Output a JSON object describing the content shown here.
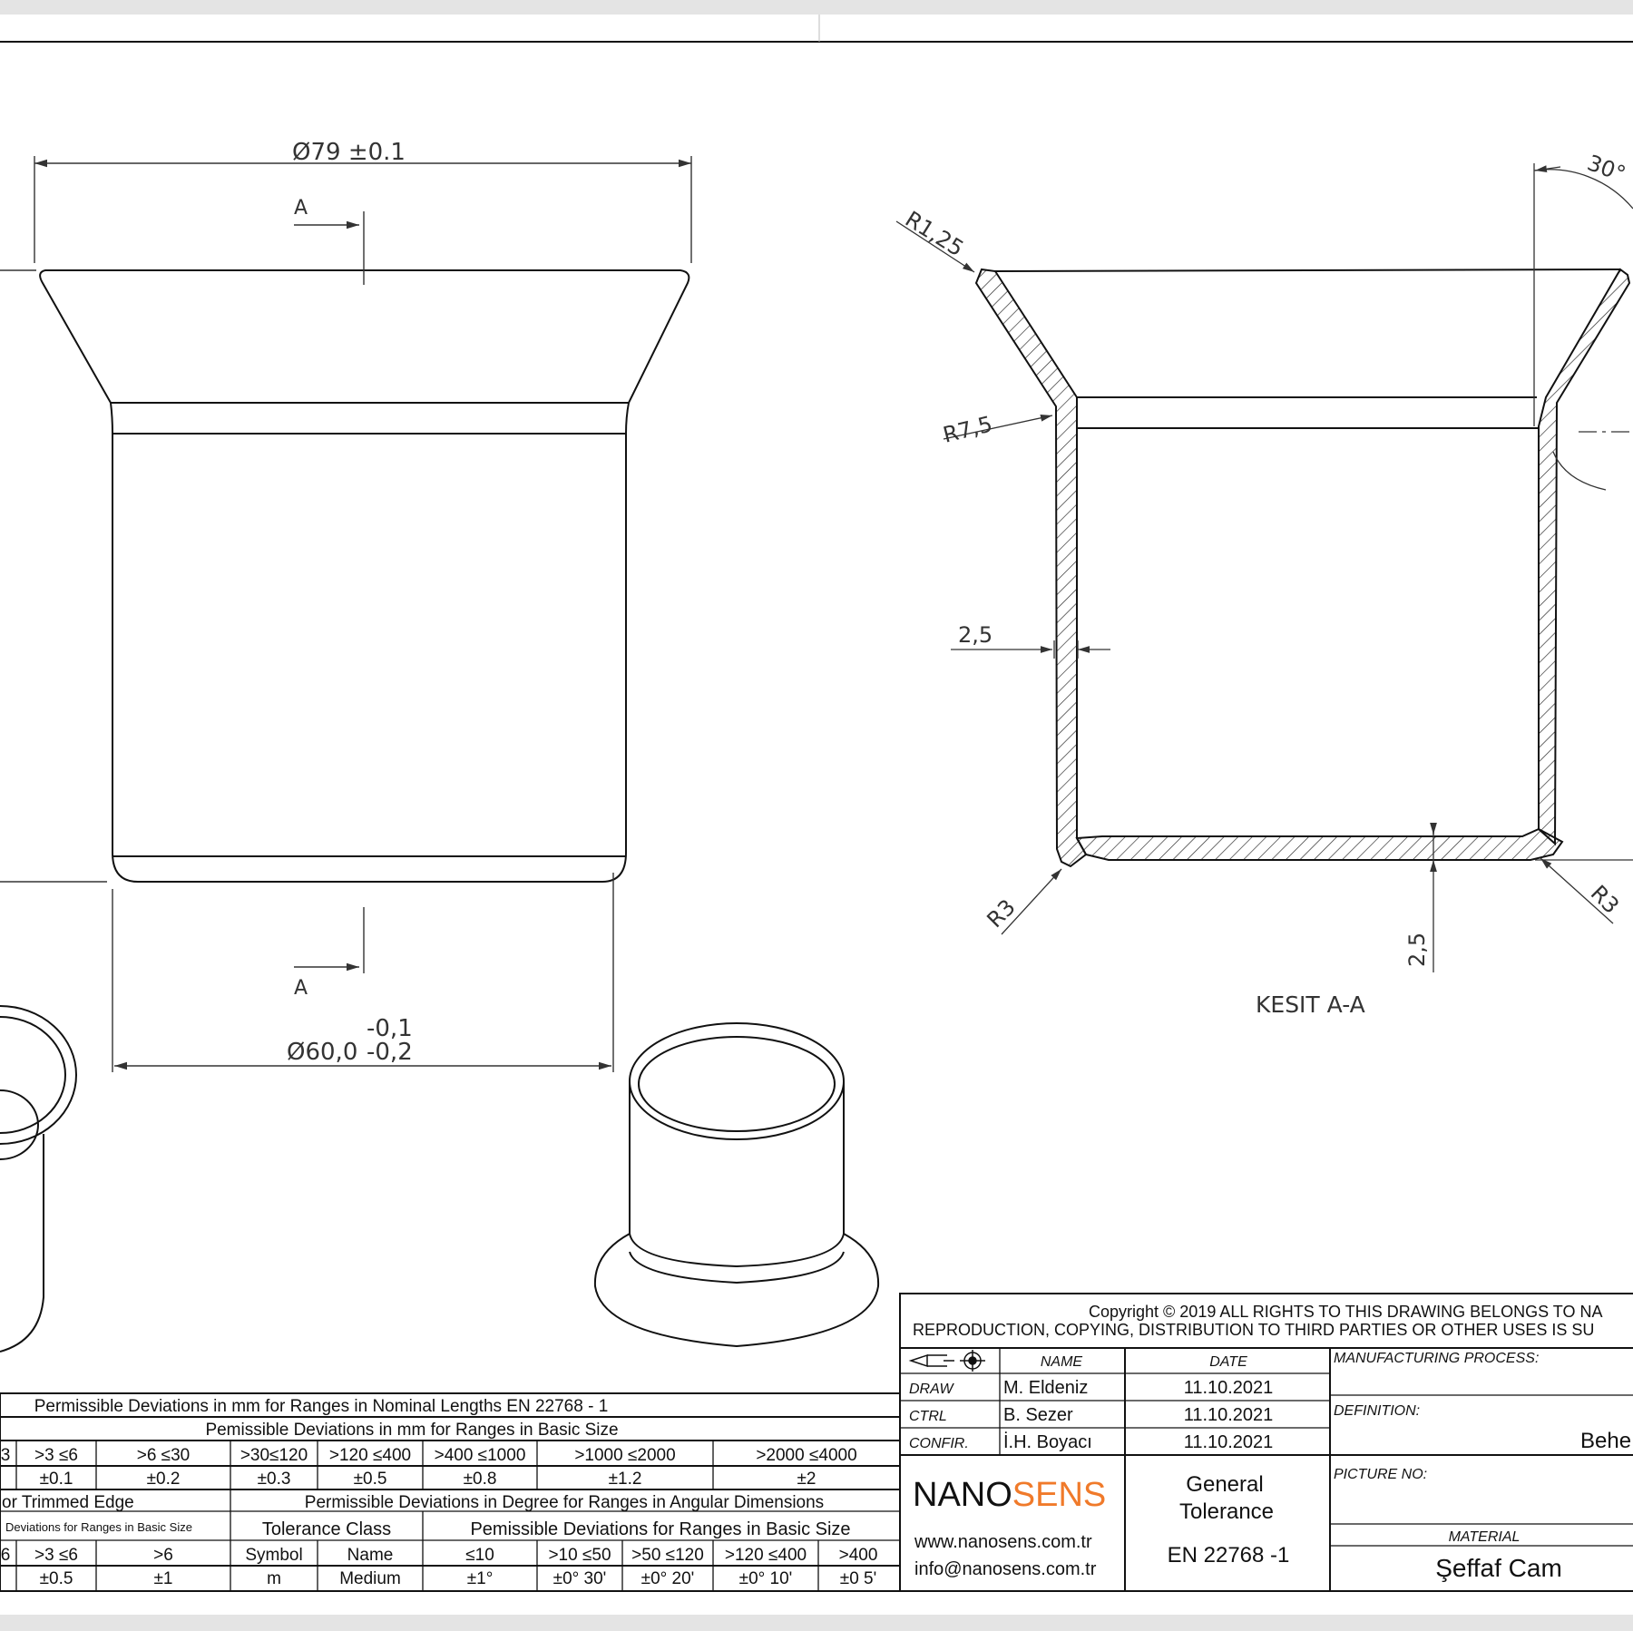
{
  "front_view": {
    "top_diameter": "Ø79 ±0.1",
    "bottom_diameter": "Ø60,0",
    "bottom_tol_upper": "-0,1",
    "bottom_tol_lower": "-0,2",
    "section_marker": "A"
  },
  "section_view": {
    "title": "KESIT A-A",
    "angle": "30°",
    "r_top": "R1,25",
    "r_mid": "R7,5",
    "r_bottom_left": "R3",
    "r_bottom_right": "R3",
    "wall_thickness": "2,5",
    "bottom_thickness": "2,5"
  },
  "title_block": {
    "copyright_line1": "Copyright © 2019 ALL RIGHTS TO THIS DRAWING BELONGS TO NA",
    "copyright_line2": "REPRODUCTION, COPYING, DISTRIBUTION TO THIRD PARTIES OR OTHER USES IS SU",
    "col_name": "NAME",
    "col_date": "DATE",
    "rows": [
      {
        "role": "DRAW",
        "name": "M. Eldeniz",
        "date": "11.10.2021"
      },
      {
        "role": "CTRL",
        "name": "B. Sezer",
        "date": "11.10.2021"
      },
      {
        "role": "CONFIR.",
        "name": "İ.H. Boyacı",
        "date": "11.10.2021"
      }
    ],
    "brand_a": "NANO",
    "brand_b": "SENS",
    "brand_color_a": "#111111",
    "brand_color_b": "#f07a2a",
    "website": "www.nanosens.com.tr",
    "email": "info@nanosens.com.tr",
    "general_l1": "General",
    "general_l2": "Tolerance",
    "standard": "EN 22768 -1",
    "manufacturing_label": "MANUFACTURING PROCESS:",
    "definition_label": "DEFINITION:",
    "definition_value": "Behe",
    "picture_label": "PICTURE NO:",
    "material_label": "MATERIAL",
    "material_value": "Şeffaf Cam"
  },
  "tolerance_table": {
    "header1": "Permissible Deviations in mm for Ranges in Nominal Lengths EN 22768 - 1",
    "header2": "Pemissible Deviations in mm for Ranges in Basic Size",
    "ranges": [
      "3",
      ">3   ≤6",
      ">6   ≤30",
      ">30≤120",
      ">120 ≤400",
      ">400 ≤1000",
      ">1000  ≤2000",
      ">2000  ≤4000"
    ],
    "values": [
      "",
      "±0.1",
      "±0.2",
      "±0.3",
      "±0.5",
      "±0.8",
      "±1.2",
      "±2"
    ],
    "trimmed_edge": "or Trimmed Edge",
    "angular_header": "Permissible Deviations in Degree for Ranges in Angular Dimensions",
    "small_dev": "Deviations for Ranges in Basic Size",
    "tol_class": "Tolerance Class",
    "basic_size2": "Pemissible Deviations for Ranges in Basic Size",
    "e_ranges": [
      "6",
      ">3   ≤6",
      ">6"
    ],
    "e_values": [
      "",
      "±0.5",
      "±1"
    ],
    "symbol_h": "Symbol",
    "name_h": "Name",
    "symbol": "m",
    "class_name": "Medium",
    "a_ranges": [
      "≤10",
      ">10  ≤50",
      ">50 ≤120",
      ">120 ≤400",
      ">400"
    ],
    "a_values": [
      "±1°",
      "±0° 30'",
      "±0° 20'",
      "±0°  10'",
      "±0  5'"
    ]
  }
}
